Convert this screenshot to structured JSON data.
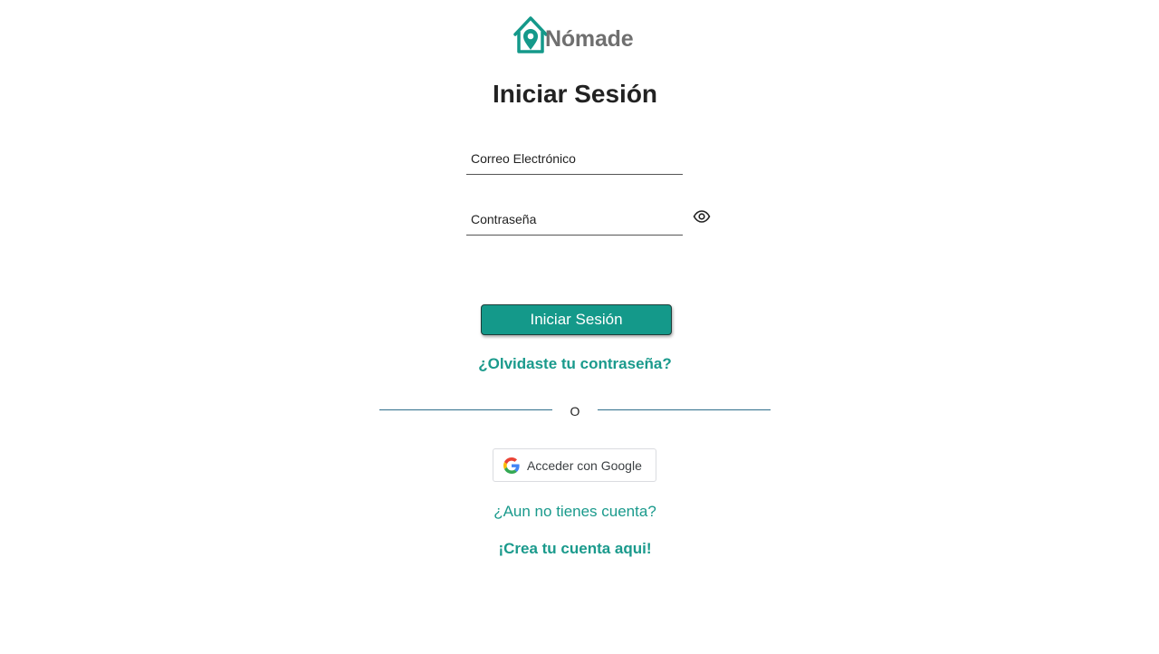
{
  "brand": {
    "name": "Nómade",
    "accent_color": "#14998a",
    "logo_icon": "house-location-pin-icon"
  },
  "login": {
    "title": "Iniciar Sesión",
    "email_placeholder": "Correo Electrónico",
    "password_placeholder": "Contraseña",
    "show_password_icon": "eye-icon",
    "submit_label": "Iniciar Sesión",
    "forgot_link": "¿Olvidaste tu contraseña?"
  },
  "divider": {
    "text": "O"
  },
  "google": {
    "label": "Acceder con Google",
    "icon": "google-g-icon"
  },
  "signup": {
    "prompt": "¿Aun no tienes cuenta?",
    "link": "¡Crea tu cuenta aqui!"
  }
}
